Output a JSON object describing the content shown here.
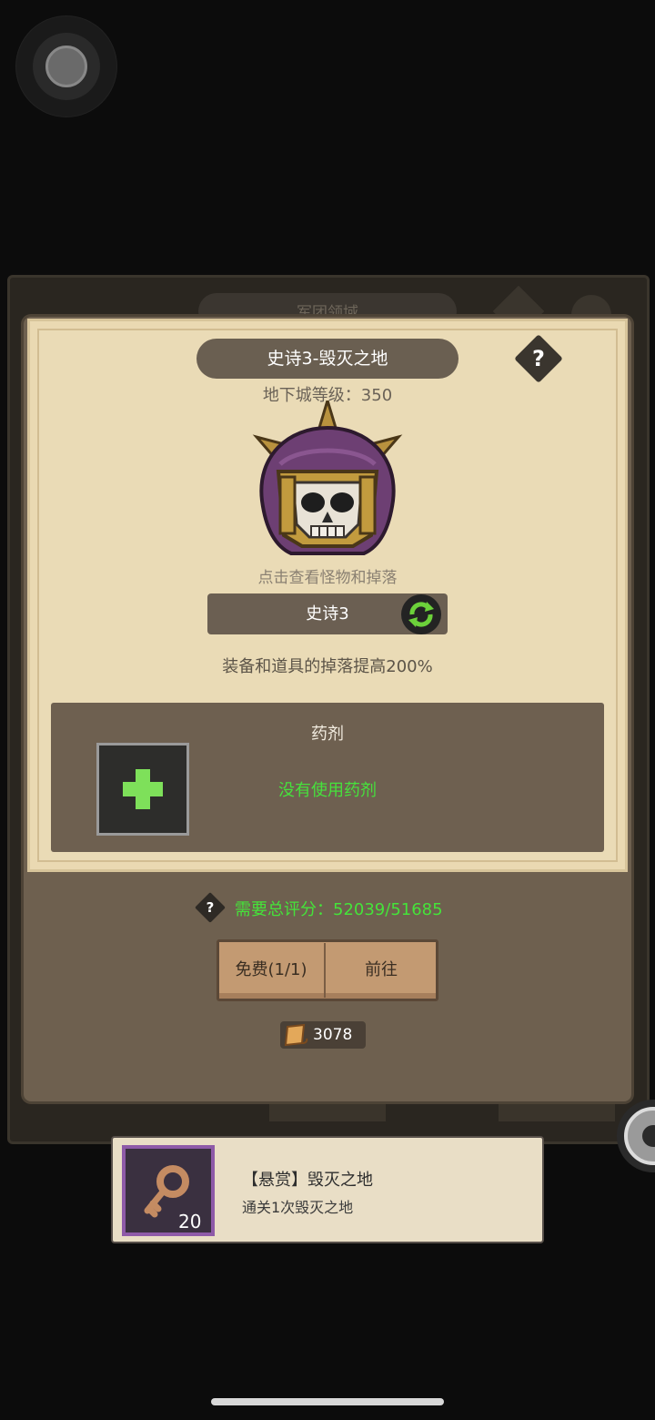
{
  "background": {
    "tab_label": "军团领域"
  },
  "dialog": {
    "title": "史诗3-毁灭之地",
    "help_symbol": "?",
    "dungeon_level": "地下城等级：350",
    "boss_hint": "点击查看怪物和掉落",
    "difficulty": "史诗3",
    "drop_bonus": "装备和道具的掉落提高200%",
    "potion": {
      "title": "药剂",
      "status": "没有使用药剂"
    },
    "requirement": {
      "help_symbol": "?",
      "text": "需要总评分：52039/51685"
    },
    "buttons": {
      "free": "免费(1/1)",
      "go": "前往"
    },
    "cost": "3078"
  },
  "quest": {
    "title": "【悬赏】毁灭之地",
    "description": "通关1次毁灭之地",
    "count": "20"
  },
  "colors": {
    "green_text": "#46e23c",
    "paper": "#eadbb6",
    "panel": "#6e6050"
  }
}
